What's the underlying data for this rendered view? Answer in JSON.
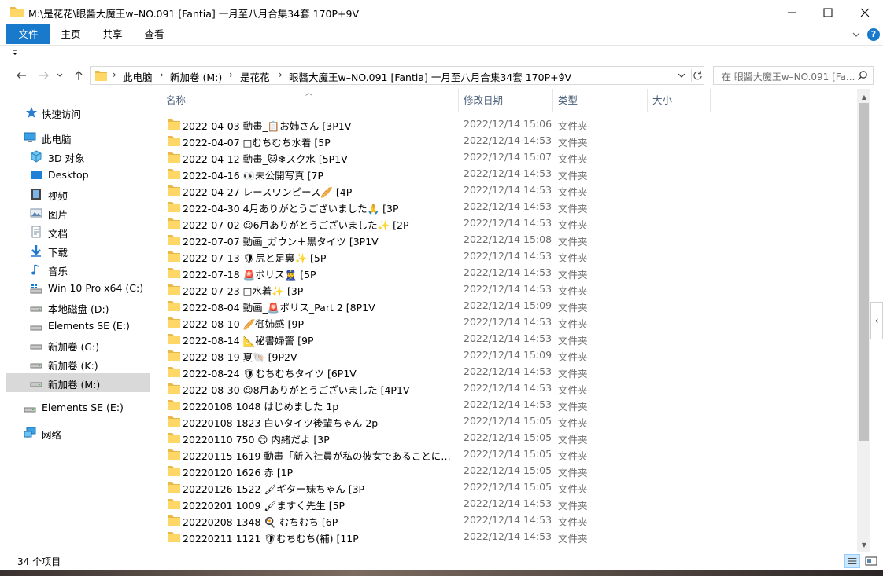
{
  "window": {
    "title": "M:\\是花花\\眼醬大魔王w–NO.091 [Fantia] 一月至八月合集34套 170P+9V"
  },
  "ribbon": {
    "tabs": [
      "文件",
      "主页",
      "共享",
      "查看"
    ],
    "help": "?"
  },
  "address": {
    "crumbs": [
      "此电脑",
      "新加卷 (M:)",
      "是花花",
      "眼醬大魔王w–NO.091 [Fantia] 一月至八月合集34套 170P+9V"
    ]
  },
  "search": {
    "placeholder": "在 眼醬大魔王w–NO.091 [Fa..."
  },
  "sidebar": {
    "items": [
      {
        "label": "快速访问",
        "icon": "star-icon"
      },
      {
        "label": "此电脑",
        "icon": "computer-icon"
      },
      {
        "label": "3D 对象",
        "icon": "3d-objects-icon"
      },
      {
        "label": "Desktop",
        "icon": "desktop-icon"
      },
      {
        "label": "视频",
        "icon": "video-icon"
      },
      {
        "label": "图片",
        "icon": "pictures-icon"
      },
      {
        "label": "文档",
        "icon": "documents-icon"
      },
      {
        "label": "下载",
        "icon": "downloads-icon"
      },
      {
        "label": "音乐",
        "icon": "music-icon"
      },
      {
        "label": "Win 10 Pro x64 (C:)",
        "icon": "windows-drive-icon"
      },
      {
        "label": "本地磁盘 (D:)",
        "icon": "drive-icon"
      },
      {
        "label": "Elements SE (E:)",
        "icon": "drive-icon"
      },
      {
        "label": "新加卷 (G:)",
        "icon": "drive-icon"
      },
      {
        "label": "新加卷 (K:)",
        "icon": "drive-icon"
      },
      {
        "label": "新加卷 (M:)",
        "icon": "drive-icon"
      },
      {
        "label": "Elements SE (E:)",
        "icon": "drive-icon"
      },
      {
        "label": "网络",
        "icon": "network-icon"
      }
    ]
  },
  "columns": [
    "名称",
    "修改日期",
    "类型",
    "大小"
  ],
  "files": [
    {
      "name": "2022-04-03 動畫_📋お姉さん [3P1V",
      "date": "2022/12/14 15:06",
      "type": "文件夹"
    },
    {
      "name": "2022-04-07 □むちむち水着 [5P",
      "date": "2022/12/14 14:53",
      "type": "文件夹"
    },
    {
      "name": "2022-04-12 動畫_🐱❄スク水 [5P1V",
      "date": "2022/12/14 15:07",
      "type": "文件夹"
    },
    {
      "name": "2022-04-16 👀未公開写真 [7P",
      "date": "2022/12/14 14:53",
      "type": "文件夹"
    },
    {
      "name": "2022-04-27 レースワンピース🥖 [4P",
      "date": "2022/12/14 14:53",
      "type": "文件夹"
    },
    {
      "name": "2022-04-30 4月ありがとうございました🙏 [3P",
      "date": "2022/12/14 14:53",
      "type": "文件夹"
    },
    {
      "name": "2022-07-02 ☺6月ありがとうございました✨ [2P",
      "date": "2022/12/14 14:53",
      "type": "文件夹"
    },
    {
      "name": "2022-07-07 動画_ガウン＋黒タイツ [3P1V",
      "date": "2022/12/14 15:08",
      "type": "文件夹"
    },
    {
      "name": "2022-07-13 🛡尻と足裏✨ [5P",
      "date": "2022/12/14 14:53",
      "type": "文件夹"
    },
    {
      "name": "2022-07-18 🚨ポリス👮‍♀ [5P",
      "date": "2022/12/14 14:53",
      "type": "文件夹"
    },
    {
      "name": "2022-07-23 □水着✨ [3P",
      "date": "2022/12/14 14:53",
      "type": "文件夹"
    },
    {
      "name": "2022-08-04 動画_🚨ポリス_Part 2 [8P1V",
      "date": "2022/12/14 15:09",
      "type": "文件夹"
    },
    {
      "name": "2022-08-10 🥖御姉感 [9P",
      "date": "2022/12/14 14:53",
      "type": "文件夹"
    },
    {
      "name": "2022-08-14 📐秘書婦警 [9P",
      "date": "2022/12/14 14:53",
      "type": "文件夹"
    },
    {
      "name": "2022-08-19 夏🐚 [9P2V",
      "date": "2022/12/14 15:09",
      "type": "文件夹"
    },
    {
      "name": "2022-08-24 🛡むちむちタイツ [6P1V",
      "date": "2022/12/14 14:53",
      "type": "文件夹"
    },
    {
      "name": "2022-08-30 ☺8月ありがとうございました [4P1V",
      "date": "2022/12/14 14:53",
      "type": "文件夹"
    },
    {
      "name": "20220108 1048 はじめました 1p",
      "date": "2022/12/14 14:53",
      "type": "文件夹"
    },
    {
      "name": "20220108 1823 白いタイツ後輩ちゃん 2p",
      "date": "2022/12/14 15:05",
      "type": "文件夹"
    },
    {
      "name": "20220110 750 😊 内緒だよ [3P",
      "date": "2022/12/14 15:05",
      "type": "文件夹"
    },
    {
      "name": "20220115 1619 動畫「新入社員が私の彼女であることについ...",
      "date": "2022/12/14 15:05",
      "type": "文件夹"
    },
    {
      "name": "20220120 1626 赤 [1P",
      "date": "2022/12/14 15:05",
      "type": "文件夹"
    },
    {
      "name": "20220126 1522 🖌ギター妹ちゃん [3P",
      "date": "2022/12/14 15:05",
      "type": "文件夹"
    },
    {
      "name": "20220201 1009 🖌ますく先生 [5P",
      "date": "2022/12/14 14:53",
      "type": "文件夹"
    },
    {
      "name": "20220208 1348 🍳 むちむち [6P",
      "date": "2022/12/14 14:53",
      "type": "文件夹"
    },
    {
      "name": "20220211 1121 🛡むちむち(補) [11P",
      "date": "2022/12/14 14:53",
      "type": "文件夹"
    }
  ],
  "status": {
    "count": "34 个项目"
  },
  "colors": {
    "accent": "#1979ca",
    "folder": "#ffd767",
    "selected": "#cce8ff"
  }
}
